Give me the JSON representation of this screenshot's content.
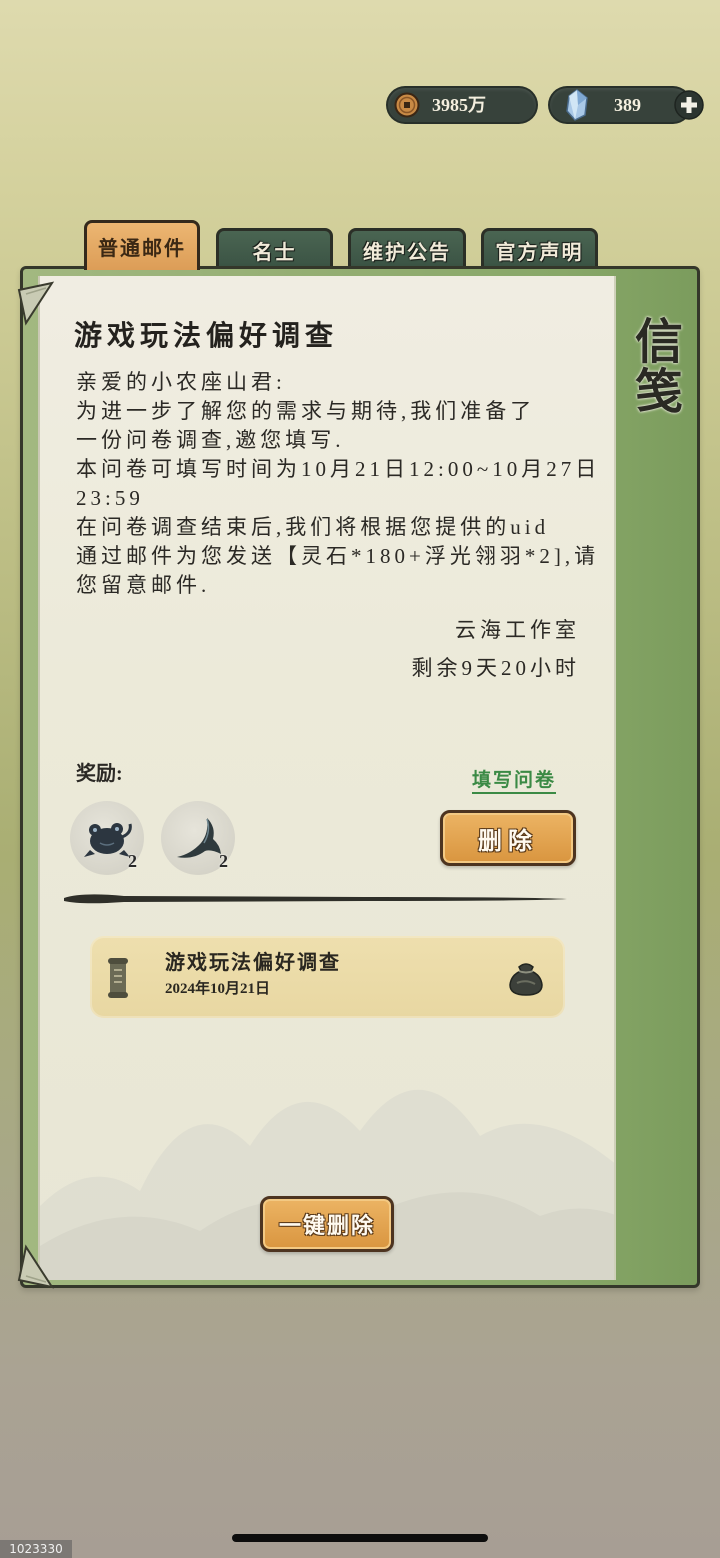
{
  "currency": {
    "coins": {
      "value": "3985万",
      "icon": "copper-coin-icon"
    },
    "gems": {
      "value": "389",
      "icon": "crystal-gem-icon",
      "add_icon": "plus-icon"
    }
  },
  "tabs": [
    {
      "label": "普通邮件",
      "active": true
    },
    {
      "label": "名士",
      "active": false
    },
    {
      "label": "维护公告",
      "active": false
    },
    {
      "label": "官方声明",
      "active": false
    }
  ],
  "panel_title": "信笺",
  "mail": {
    "title": "游戏玩法偏好调查",
    "body_lines": [
      "亲爱的小农座山君:",
      "为进一步了解您的需求与期待,我们准备了",
      "一份问卷调查,邀您填写.",
      "本问卷可填写时间为10月21日12:00~10月27日",
      "23:59",
      "在问卷调查结束后,我们将根据您提供的uid",
      "通过邮件为您发送【灵石*180+浮光翎羽*2],请",
      "您留意邮件."
    ],
    "sender": "云海工作室",
    "time_left": "剩余9天20小时",
    "rewards_label": "奖励:",
    "survey_link": "填写问卷",
    "rewards": [
      {
        "icon": "creature-icon",
        "count": "2"
      },
      {
        "icon": "feather-icon",
        "count": "2"
      }
    ],
    "delete_label": "删除"
  },
  "mail_list": [
    {
      "title": "游戏玩法偏好调查",
      "date": "2024年10月21日",
      "icon": "scroll-icon",
      "attachment_icon": "pouch-icon"
    }
  ],
  "delete_all_label": "一键删除",
  "watermark": "1023330",
  "colors": {
    "tab_active": "#e3a965",
    "tab_inactive": "#3e5747",
    "button_orange": "#e2a24e",
    "link_green": "#3b8a45",
    "paper": "#ece9da",
    "frame_green": "#8aa86a",
    "list_item": "#e8d7a2"
  }
}
